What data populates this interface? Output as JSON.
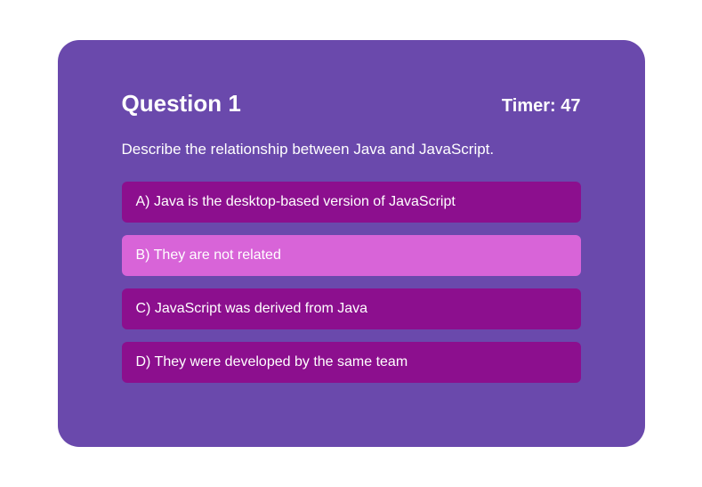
{
  "header": {
    "question_label": "Question 1",
    "timer_text": "Timer: 47"
  },
  "question": {
    "text": "Describe the relationship between Java and JavaScript."
  },
  "options": [
    {
      "label": "A) Java is the desktop-based version of JavaScript",
      "selected": false
    },
    {
      "label": "B) They are not related",
      "selected": true
    },
    {
      "label": "C) JavaScript was derived from Java",
      "selected": false
    },
    {
      "label": "D) They were developed by the same team",
      "selected": false
    }
  ],
  "colors": {
    "card_bg": "#6a49ac",
    "option_bg": "#8c0f8e",
    "option_selected_bg": "#d864d8",
    "text": "#ffffff"
  }
}
